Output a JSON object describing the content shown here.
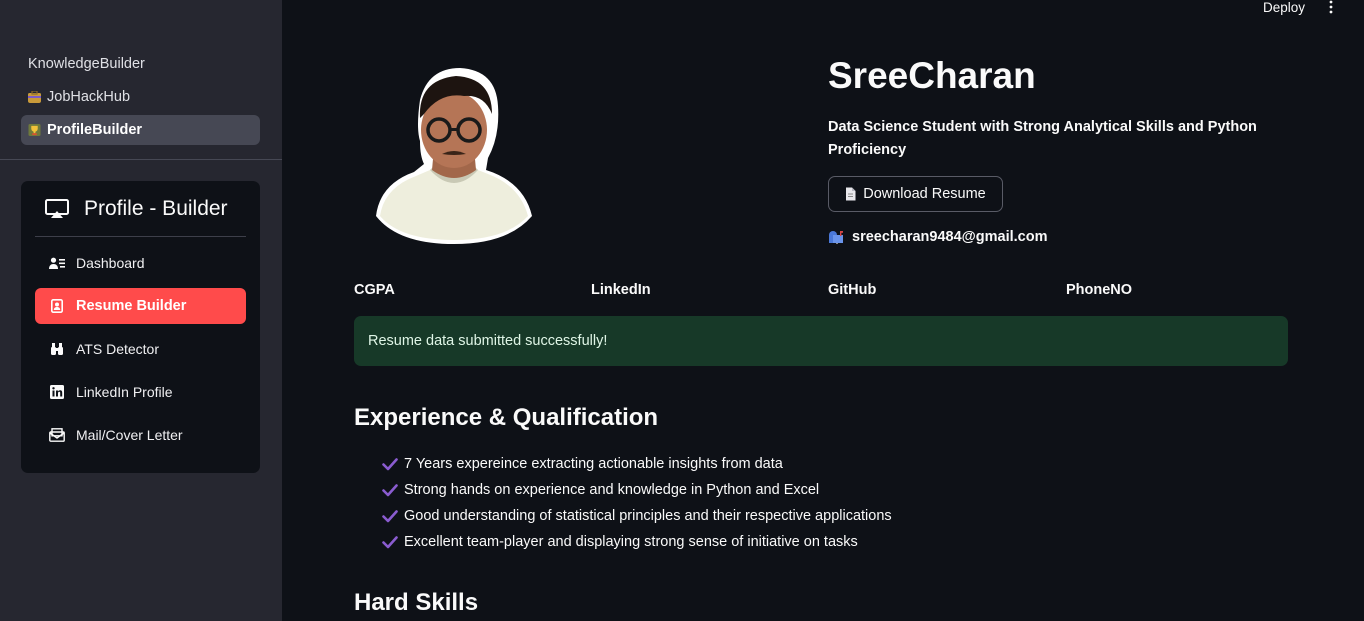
{
  "header": {
    "deploy_label": "Deploy"
  },
  "sidebar": {
    "pages": [
      {
        "label": "KnowledgeBuilder",
        "icon": ""
      },
      {
        "label": "JobHackHub",
        "icon": "briefcase-emoji-icon"
      },
      {
        "label": "ProfileBuilder",
        "icon": "trophy-emoji-icon",
        "active": true
      }
    ],
    "menu": {
      "title": "Profile - Builder",
      "title_icon": "airplay-icon",
      "items": [
        {
          "label": "Dashboard",
          "icon": "person-lines-icon"
        },
        {
          "label": "Resume Builder",
          "icon": "badge-icon",
          "selected": true
        },
        {
          "label": "ATS Detector",
          "icon": "binoculars-icon"
        },
        {
          "label": "LinkedIn Profile",
          "icon": "linkedin-icon"
        },
        {
          "label": "Mail/Cover Letter",
          "icon": "envelope-paper-icon"
        }
      ],
      "selected_color": "#ff4b4b"
    }
  },
  "profile": {
    "name": "SreeCharan",
    "tagline": "Data Science Student with Strong Analytical Skills and Python Proficiency",
    "download_label": "Download Resume",
    "email": "sreecharan9484@gmail.com"
  },
  "stats": {
    "cgpa": "CGPA",
    "linkedin": "LinkedIn",
    "github": "GitHub",
    "phone": "PhoneNO"
  },
  "alert": {
    "message": "Resume data submitted successfully!",
    "color": "#173928"
  },
  "experience": {
    "heading": "Experience & Qualification",
    "items": [
      "7 Years expereince extracting actionable insights from data",
      "Strong hands on experience and knowledge in Python and Excel",
      "Good understanding of statistical principles and their respective applications",
      "Excellent team-player and displaying strong sense of initiative on tasks"
    ],
    "check_color": "#8a5cd0"
  },
  "skills": {
    "heading": "Hard Skills"
  }
}
